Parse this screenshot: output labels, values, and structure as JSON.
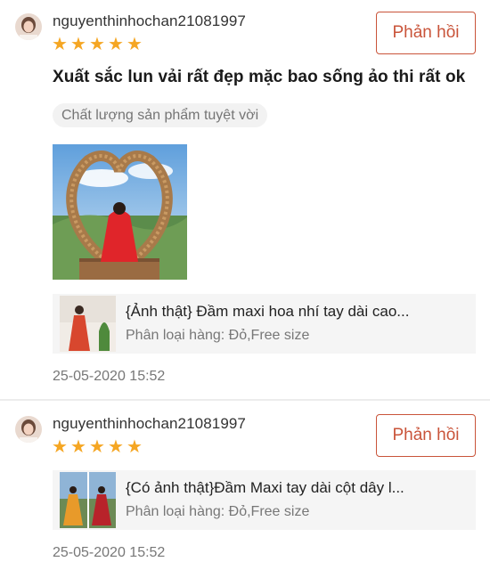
{
  "reviews": [
    {
      "username": "nguyenthinhochan21081997",
      "rating": 5,
      "reply_label": "Phản hồi",
      "comment": "Xuất sắc lun vải rất đẹp mặc bao sống ảo thi rất ok",
      "tag": "Chất lượng sản phẩm tuyệt vời",
      "product": {
        "name": "{Ảnh thật} Đầm maxi hoa nhí tay dài cao...",
        "variant": "Phân loại hàng: Đỏ,Free size"
      },
      "timestamp": "25-05-2020 15:52"
    },
    {
      "username": "nguyenthinhochan21081997",
      "rating": 5,
      "reply_label": "Phản hồi",
      "product": {
        "name": "{Có ảnh thật}Đầm Maxi tay dài cột dây l...",
        "variant": "Phân loại hàng: Đỏ,Free size"
      },
      "timestamp": "25-05-2020 15:52"
    }
  ],
  "colors": {
    "accent": "#c9543a",
    "star": "#f5a623",
    "product_bg": "#f5f5f5"
  }
}
